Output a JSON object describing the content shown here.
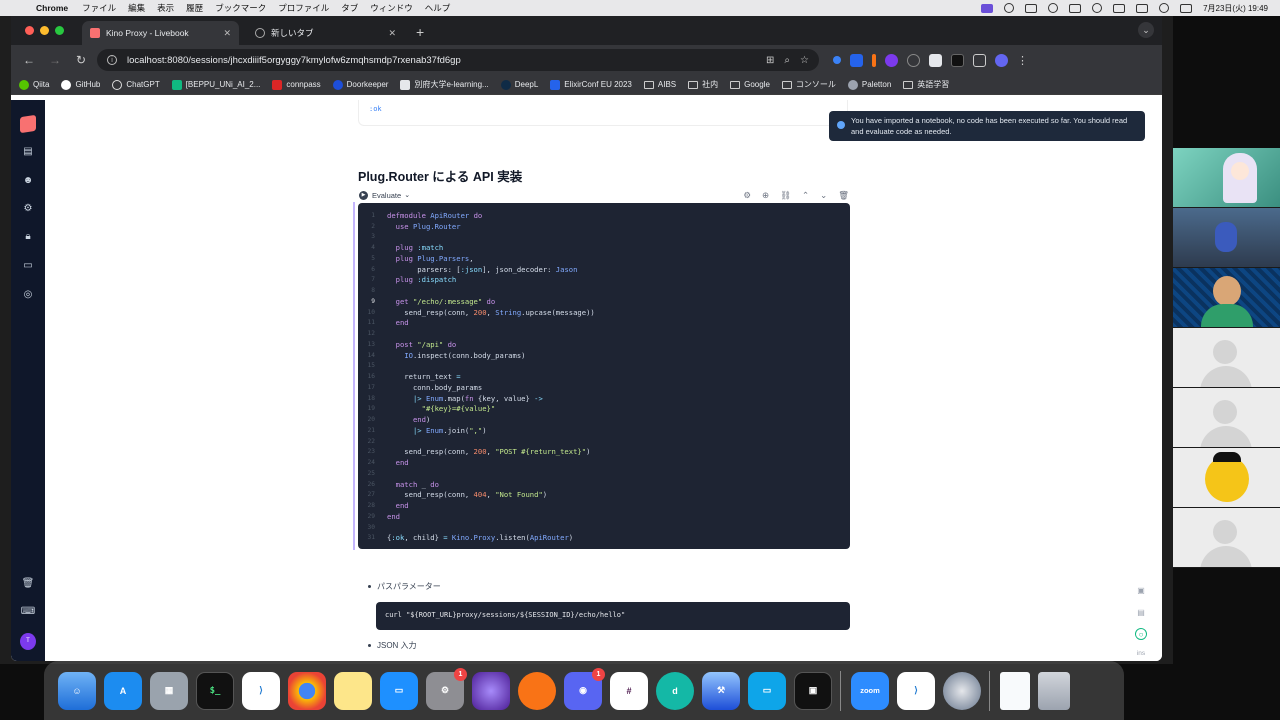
{
  "menubar": {
    "app": "Chrome",
    "items": [
      "ファイル",
      "編集",
      "表示",
      "履歴",
      "ブックマーク",
      "プロファイル",
      "タブ",
      "ウィンドウ",
      "ヘルプ"
    ],
    "datetime": "7月23日(火) 19:49"
  },
  "tabs": [
    {
      "title": "Kino Proxy - Livebook"
    },
    {
      "title": "新しいタブ"
    }
  ],
  "address": {
    "url": "localhost:8080/sessions/jhcxdiiif5orgyggy7kmylofw6zmqhsmdp7rxenab37fd6gp"
  },
  "bookmarks": [
    "Qiita",
    "GitHub",
    "ChatGPT",
    "[BEPPU_UNi_AI_2...",
    "connpass",
    "Doorkeeper",
    "別府大学e-learning...",
    "DeepL",
    "ElixirConf EU 2023",
    "AIBS",
    "社内",
    "Google",
    "コンソール",
    "Paletton",
    "英語学習"
  ],
  "notebook": {
    "prev_output": ":ok",
    "toast": "You have imported a notebook, no code has been executed so far. You should read and evaluate code as needed.",
    "heading": "Plug.Router による API 実装",
    "evaluate_label": "Evaluate",
    "cursor_line": 9,
    "code": [
      "defmodule ApiRouter do",
      "  use Plug.Router",
      "",
      "  plug :match",
      "  plug Plug.Parsers,",
      "       parsers: [:json], json_decoder: Jason",
      "  plug :dispatch",
      "",
      "  get \"/echo/:message\" do",
      "    send_resp(conn, 200, String.upcase(message))",
      "  end",
      "",
      "  post \"/api\" do",
      "    IO.inspect(conn.body_params)",
      "",
      "    return_text =",
      "      conn.body_params",
      "      |> Enum.map(fn {key, value} ->",
      "        \"#{key}=#{value}\"",
      "      end)",
      "      |> Enum.join(\",\")",
      "",
      "    send_resp(conn, 200, \"POST #{return_text}\")",
      "  end",
      "",
      "  match _ do",
      "    send_resp(conn, 404, \"Not Found\")",
      "  end",
      "end",
      "",
      "{:ok, child} = Kino.Proxy.listen(ApiRouter)"
    ],
    "bullet1": "パスパラメーター",
    "curl": "curl \"${ROOT_URL}proxy/sessions/${SESSION_ID}/echo/hello\"",
    "bullet2": "JSON 入力",
    "ins_label": "ins"
  },
  "dock": {
    "zoom_label": "zoom",
    "badges": [
      "1",
      "1"
    ]
  },
  "colors": {
    "keyword": "#c792ea",
    "module": "#82aaff",
    "atom": "#89ddff",
    "string": "#c3e88d",
    "number": "#f78c6c",
    "plain": "#d6deeb"
  }
}
